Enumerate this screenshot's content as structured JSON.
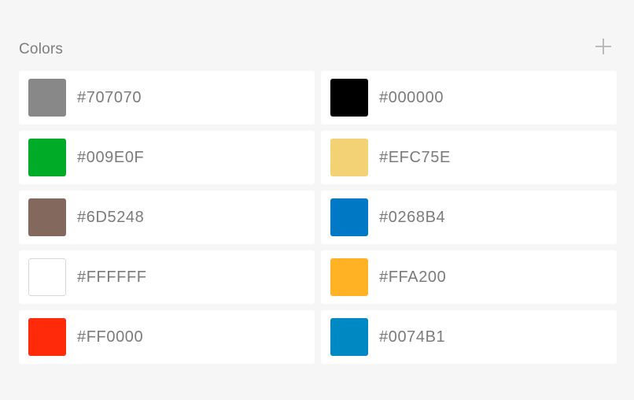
{
  "section": {
    "title": "Colors",
    "add_label": "+"
  },
  "colors": [
    {
      "label": "#707070",
      "swatch": "#888888"
    },
    {
      "label": "#000000",
      "swatch": "#000000"
    },
    {
      "label": "#009E0F",
      "swatch": "#00ac27"
    },
    {
      "label": "#EFC75E",
      "swatch": "#f3d275"
    },
    {
      "label": "#6D5248",
      "swatch": "#83685d"
    },
    {
      "label": "#0268B4",
      "swatch": "#0078c3"
    },
    {
      "label": "#FFFFFF",
      "swatch": "#ffffff",
      "bordered": true
    },
    {
      "label": "#FFA200",
      "swatch": "#ffb224"
    },
    {
      "label": "#FF0000",
      "swatch": "#ff2a0a"
    },
    {
      "label": "#0074B1",
      "swatch": "#0088c2"
    }
  ]
}
